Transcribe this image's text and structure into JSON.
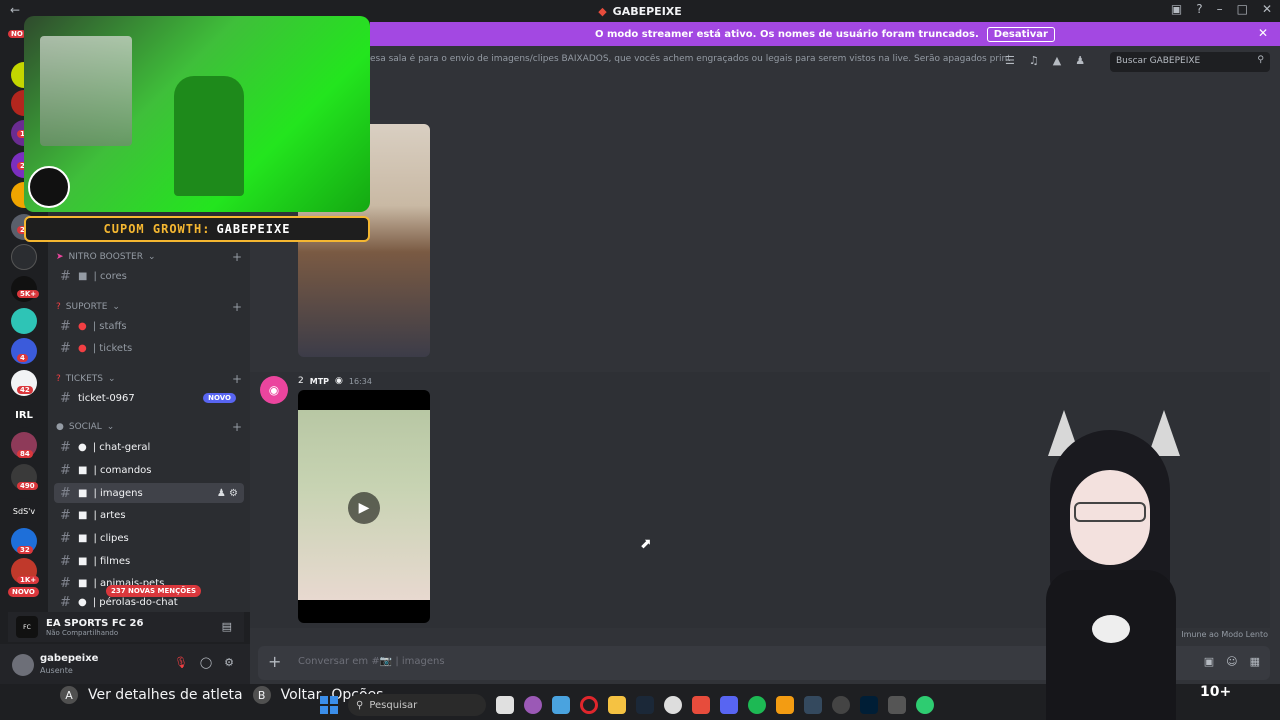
{
  "window": {
    "title": "GABEPEIXE",
    "back_icon": "arrow-left-icon"
  },
  "banner": {
    "text": "O modo streamer está ativo. Os nomes de usuário foram truncados.",
    "button": "Desativar"
  },
  "guild_badges": [
    "NO",
    "1",
    "235",
    "21",
    "5K+",
    "4",
    "42",
    "84",
    "490",
    "32",
    "1K+"
  ],
  "guild_labels": [
    "IRL",
    "SdS'v"
  ],
  "novo_left": "NOVO",
  "sidebar": {
    "categories": [
      {
        "label": "NITRO BOOSTER"
      },
      {
        "label": "SUPORTE"
      },
      {
        "label": "TICKETS"
      },
      {
        "label": "SOCIAL"
      }
    ],
    "channels": {
      "cores": "| cores",
      "staffs": "| staffs",
      "tickets": "| tickets",
      "ticket": "ticket-0967",
      "chat_geral": "| chat-geral",
      "comandos": "| comandos",
      "imagens": "| imagens",
      "artes": "| artes",
      "clipes": "| clipes",
      "filmes": "| filmes",
      "animais": "| animais-pets",
      "perolas": "| pérolas-do-chat"
    },
    "novo_badge": "NOVO",
    "mentions": "237 NOVAS MENÇÕES"
  },
  "activity": {
    "game": "EA SPORTS FC 26",
    "status": "Não Compartilhando",
    "logo_text": "FC"
  },
  "user": {
    "name": "gabepeixe",
    "status": "Ausente"
  },
  "channel": {
    "topic": "esa sala é para o envio de imagens/clipes BAIXADOS, que vocês achem engraçados ou legais para serem vistos na live. Serão apagados prints de outras rede...",
    "search_placeholder": "Buscar GABEPEIXE"
  },
  "message": {
    "author": "2",
    "tag": "MTP",
    "time": "16:34"
  },
  "slowmode": "Imune ao Modo Lento",
  "composer": {
    "placeholder": "Conversar em #📷 | imagens"
  },
  "stream_overlay": {
    "coupon_label": "CUPOM GROWTH:",
    "coupon_code": "GABEPEIXE"
  },
  "game_overlay": {
    "a_label": "Ver detalhes de atleta",
    "b_label": "Voltar",
    "options": "Opções",
    "a": "A",
    "b": "B",
    "right_text": "10+"
  },
  "taskbar": {
    "search": "Pesquisar"
  },
  "colors": {
    "accent": "#a348e2",
    "blurple": "#5865f2",
    "danger": "#da373c"
  }
}
